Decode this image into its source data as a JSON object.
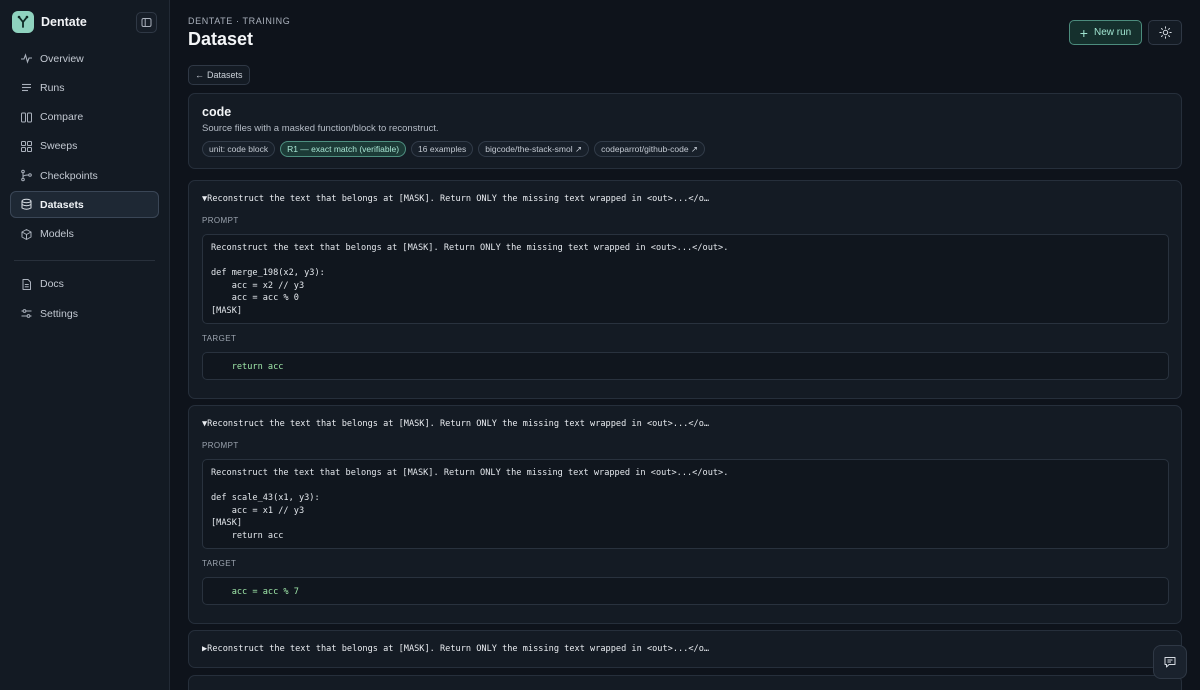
{
  "app": {
    "name": "Dentate"
  },
  "sidebar": {
    "items": [
      {
        "label": "Overview",
        "icon": "activity-icon",
        "active": false
      },
      {
        "label": "Runs",
        "icon": "list-icon",
        "active": false
      },
      {
        "label": "Compare",
        "icon": "columns-icon",
        "active": false
      },
      {
        "label": "Sweeps",
        "icon": "grid-icon",
        "active": false
      },
      {
        "label": "Checkpoints",
        "icon": "git-branch-icon",
        "active": false
      },
      {
        "label": "Datasets",
        "icon": "database-icon",
        "active": true
      },
      {
        "label": "Models",
        "icon": "cube-icon",
        "active": false
      }
    ],
    "footer_items": [
      {
        "label": "Docs",
        "icon": "document-icon"
      },
      {
        "label": "Settings",
        "icon": "sliders-icon"
      }
    ]
  },
  "header": {
    "supertitle": "DENTATE · TRAINING",
    "title": "Dataset",
    "new_run_label": "New run"
  },
  "back_button": {
    "label": "Datasets"
  },
  "dataset": {
    "name": "code",
    "description": "Source files with a masked function/block to reconstruct.",
    "chips": [
      {
        "label": "unit: code block",
        "accent": false
      },
      {
        "label": "R1 — exact match (verifiable)",
        "accent": true
      },
      {
        "label": "16 examples",
        "accent": false
      },
      {
        "label": "bigcode/the-stack-smol ↗",
        "accent": false
      },
      {
        "label": "codeparrot/github-code ↗",
        "accent": false
      }
    ]
  },
  "labels": {
    "prompt": "PROMPT",
    "target": "TARGET"
  },
  "examples": [
    {
      "expanded": true,
      "summary": "▼Reconstruct the text that belongs at [MASK]. Return ONLY the missing text wrapped in <out>...</o…",
      "prompt": "Reconstruct the text that belongs at [MASK]. Return ONLY the missing text wrapped in <out>...</out>.\n\ndef merge_198(x2, y3):\n    acc = x2 // y3\n    acc = acc % 0\n[MASK]",
      "target": "    return acc"
    },
    {
      "expanded": true,
      "summary": "▼Reconstruct the text that belongs at [MASK]. Return ONLY the missing text wrapped in <out>...</o…",
      "prompt": "Reconstruct the text that belongs at [MASK]. Return ONLY the missing text wrapped in <out>...</out>.\n\ndef scale_43(x1, y3):\n    acc = x1 // y3\n[MASK]\n    return acc",
      "target": "    acc = acc % 7"
    },
    {
      "expanded": false,
      "summary": "▶Reconstruct the text that belongs at [MASK]. Return ONLY the missing text wrapped in <out>...</o…"
    }
  ],
  "colors": {
    "accent": "#8fd3bf",
    "target_text": "#9ee6a8",
    "background": "#0e131b",
    "sidebar": "#131a23"
  }
}
